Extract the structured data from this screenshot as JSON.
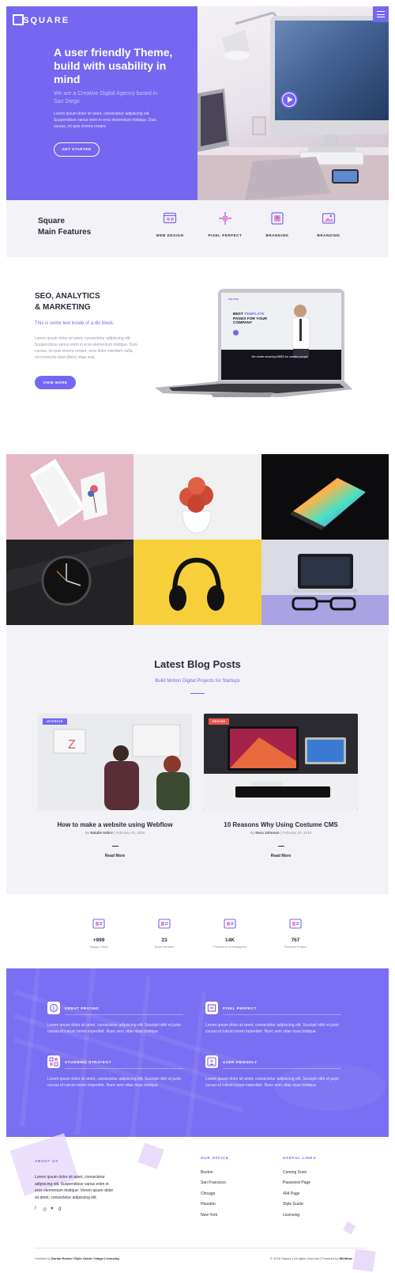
{
  "brand": {
    "logo": "SQUARE",
    "accent": "#7567f0",
    "soft_bg": "#f3f2f7"
  },
  "hero": {
    "title": "A user friendly Theme, build with usability in mind",
    "subtitle": "We are a Creative Digital Agency based in San Diego",
    "body": "Lorem ipsum dolor sit amet, consectetur adipiscing elit. Suspendisse varius enim in eros elementum tristique. Duis cursus, mi quis viverra ornare.",
    "cta": "GET STARTED",
    "menu_icon": "hamburger-icon",
    "play_icon": "play-icon"
  },
  "features": {
    "title_line1": "Square",
    "title_line2": "Main Features",
    "items": [
      {
        "label": "WEB DESIGN",
        "icon": "web-design-icon"
      },
      {
        "label": "PIXEL PERFECT",
        "icon": "pixel-perfect-icon"
      },
      {
        "label": "BRANDING",
        "icon": "branding-icon"
      },
      {
        "label": "BRANDING",
        "icon": "image-branding-icon"
      }
    ]
  },
  "seo": {
    "title_line1": "SEO, ANALYTICS",
    "title_line2": "& MARKETING",
    "subtitle": "This is some text inside of a div block.",
    "body": "Lorem ipsum dolor sit amet, consectetur adipiscing elit. Suspendisse varius enim in eros elementum tristique. Duis cursus, mi quis viverra ornare, eros dolor interdum nulla, ut commodo diam libero vitae erat.",
    "cta": "VIEW MORE",
    "laptop_screen": {
      "headline_a": "BEST ",
      "headline_b": "TEMPLATE",
      "headline_c": "PAGES FOR YOUR COMPANY",
      "bar_text": "We create amazing WEBS for creative people"
    }
  },
  "blog": {
    "title": "Latest Blog Posts",
    "subtitle": "Build Motion Digital Projects for Startups",
    "posts": [
      {
        "tag": "INTERIOR",
        "tag_color": "#7567f0",
        "title": "How to make a website using Webflow",
        "by": "By ",
        "author": "Natalie Imbro",
        "date": " | February 20, 2018",
        "read": "Read More"
      },
      {
        "tag": "DESIGN",
        "tag_color": "#e8544f",
        "title": "10 Reasons Why Using Costume CMS",
        "by": "By ",
        "author": "Nora Johnson",
        "date": " | February 20, 2018",
        "read": "Read More"
      }
    ]
  },
  "stats": [
    {
      "num": "+999",
      "label": "Happy Client"
    },
    {
      "num": "23",
      "label": "Team Member"
    },
    {
      "num": "14K",
      "label": "Followers on Instagram"
    },
    {
      "num": "767",
      "label": "Finished Project"
    }
  ],
  "band": {
    "items": [
      {
        "title": "GREAT PRICING",
        "icon": "pricing-icon",
        "body": "Lorem ipsum dolor sit amet, consectetur adipiscing elit. Suscipit nibh et justo cursus id rutrum lorem imperdiet. Nunc sem vitae risus tristique."
      },
      {
        "title": "PIXEL PERFECT",
        "icon": "pixel-icon",
        "body": "Lorem ipsum dolor sit amet, consectetur adipiscing elit. Suscipit nibh et justo cursus id rutrum lorem imperdiet. Nunc sem vitae risus tristique."
      },
      {
        "title": "STUNNING STRATEGY",
        "icon": "strategy-icon",
        "body": "Lorem ipsum dolor sit amet, consectetur adipiscing elit. Suscipit nibh et justo cursus id rutrum lorem imperdiet. Nunc sem vitae risus tristique."
      },
      {
        "title": "USER FRIENDLY",
        "icon": "user-icon",
        "body": "Lorem ipsum dolor sit amet, consectetur adipiscing elit. Suscipit nibh et justo cursus id rutrum lorem imperdiet. Nunc sem vitae risus tristique."
      }
    ]
  },
  "footer": {
    "about_heading": "ABOUT US",
    "about_text": "Lorem ipsum dolor sit amet, consectetur adipiscing elit. Suspendisse varius enim in eros elementum tristique. Vorem ipsum dolor sit amet, consectetur adipiscing elit.",
    "office_heading": "OUR OFFICE",
    "offices": [
      "Boston",
      "San Francisco",
      "Chicago",
      "Houston",
      "New York"
    ],
    "links_heading": "USEFUL LINKS",
    "links": [
      "Coming Soon",
      "Password Page",
      "404 Page",
      "Style Guide",
      "Licensing"
    ],
    "social": {
      "facebook": "f",
      "instagram": "◎",
      "twitter": "♥",
      "google": "g"
    },
    "credit_prefix": "Created by ",
    "credit_author": "Dorian Hoxha",
    "credit_links": " / Style Guide / Image Licensing",
    "copyright": "© 2018 Square | All rights reserved | Powered by ",
    "powered": "Webflow"
  }
}
